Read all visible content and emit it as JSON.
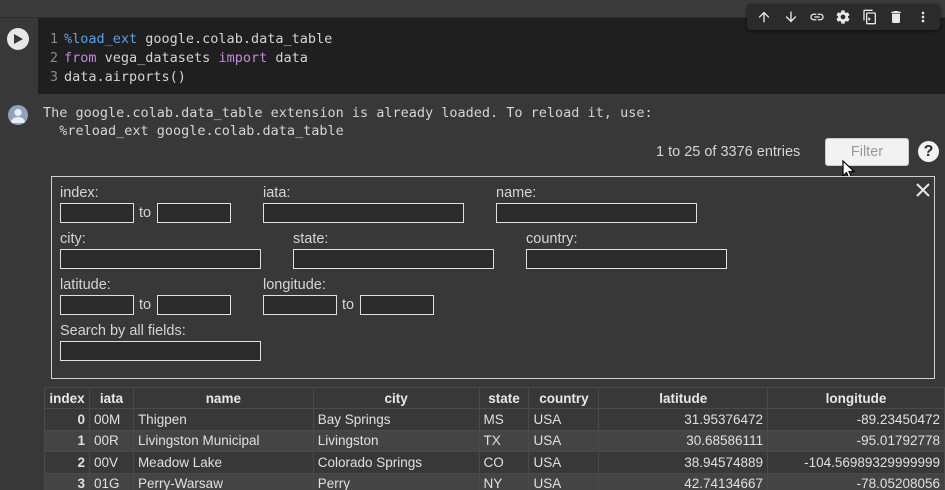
{
  "toolbar": {
    "buttons": [
      {
        "name": "move-cell-up",
        "icon": "arrow-up-icon"
      },
      {
        "name": "move-cell-down",
        "icon": "arrow-down-icon"
      },
      {
        "name": "link-to-cell",
        "icon": "link-icon"
      },
      {
        "name": "cell-settings",
        "icon": "gear-icon"
      },
      {
        "name": "mirror-cell",
        "icon": "mirror-icon"
      },
      {
        "name": "delete-cell",
        "icon": "trash-icon"
      },
      {
        "name": "more-actions",
        "icon": "kebab-icon"
      }
    ]
  },
  "code": {
    "lines": [
      {
        "num": "1",
        "parts": [
          {
            "cls": "kw-ext",
            "text": "%load_ext"
          },
          {
            "cls": "txt",
            "text": " google.colab.data_table"
          }
        ]
      },
      {
        "num": "2",
        "parts": [
          {
            "cls": "kw",
            "text": "from"
          },
          {
            "cls": "txt",
            "text": " vega_datasets "
          },
          {
            "cls": "kw",
            "text": "import"
          },
          {
            "cls": "txt",
            "text": " data"
          }
        ]
      },
      {
        "num": "3",
        "parts": [
          {
            "cls": "txt",
            "text": "data.airports()"
          }
        ]
      }
    ]
  },
  "output": {
    "message_line1": "The google.colab.data_table extension is already loaded. To reload it, use:",
    "message_line2": "  %reload_ext google.colab.data_table"
  },
  "table_controls": {
    "entries_text": "1 to 25 of 3376 entries",
    "filter_label": "Filter",
    "help_label": "?"
  },
  "filter_panel": {
    "index_label": "index:",
    "iata_label": "iata:",
    "name_label": "name:",
    "city_label": "city:",
    "state_label": "state:",
    "country_label": "country:",
    "latitude_label": "latitude:",
    "longitude_label": "longitude:",
    "search_all_label": "Search by all fields:",
    "to_label": "to"
  },
  "table": {
    "columns": [
      "index",
      "iata",
      "name",
      "city",
      "state",
      "country",
      "latitude",
      "longitude"
    ],
    "rows": [
      [
        "0",
        "00M",
        "Thigpen",
        "Bay Springs",
        "MS",
        "USA",
        "31.95376472",
        "-89.23450472"
      ],
      [
        "1",
        "00R",
        "Livingston Municipal",
        "Livingston",
        "TX",
        "USA",
        "30.68586111",
        "-95.01792778"
      ],
      [
        "2",
        "00V",
        "Meadow Lake",
        "Colorado Springs",
        "CO",
        "USA",
        "38.94574889",
        "-104.56989329999999"
      ],
      [
        "3",
        "01G",
        "Perry-Warsaw",
        "Perry",
        "NY",
        "USA",
        "42.74134667",
        "-78.05208056"
      ]
    ]
  }
}
